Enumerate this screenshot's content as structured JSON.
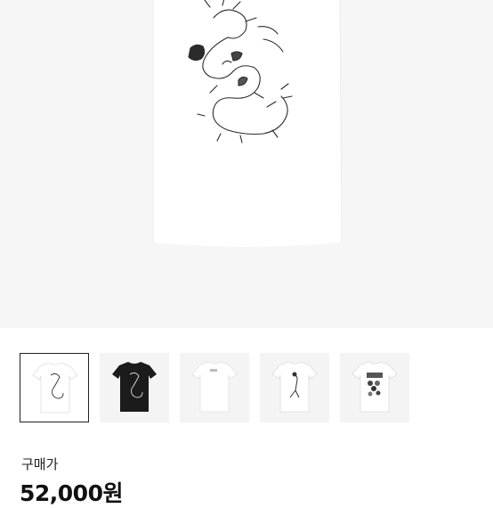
{
  "product": {
    "main_image": "white-tshirt-dragon-print",
    "thumbnails": [
      {
        "image": "white-tshirt-dragon-print",
        "selected": true
      },
      {
        "image": "black-tshirt-dragon-print",
        "selected": false
      },
      {
        "image": "white-tshirt-back",
        "selected": false
      },
      {
        "image": "white-tshirt-figure-print",
        "selected": false
      },
      {
        "image": "white-tshirt-floral-print",
        "selected": false
      }
    ]
  },
  "price": {
    "label": "구매가",
    "value": "52,000원"
  },
  "colors": {
    "hero_bg": "#f6f6f6",
    "shirt_white": "#ffffff",
    "shirt_black": "#1b1b1b",
    "selected_border": "#222222"
  }
}
